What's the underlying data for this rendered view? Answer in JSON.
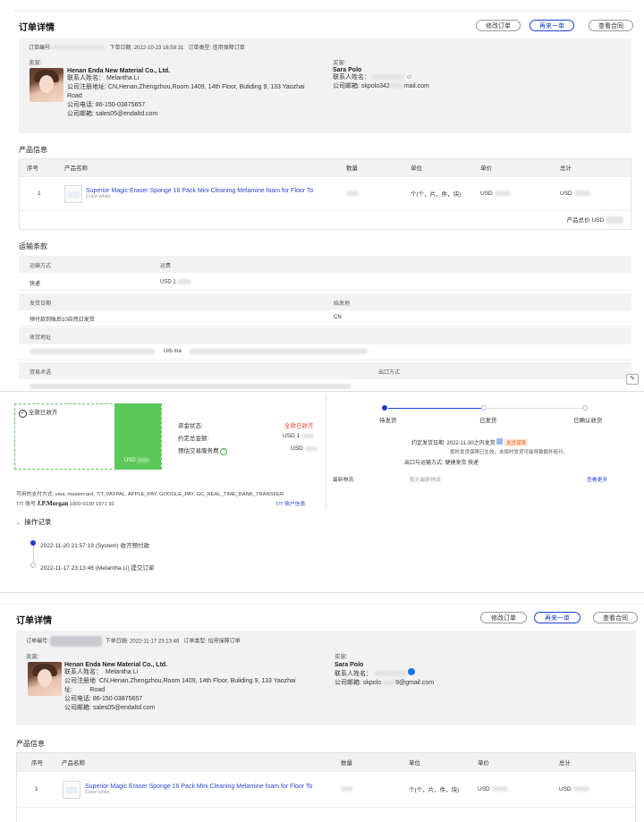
{
  "top": {
    "title": "订单详情",
    "buttons": {
      "modify": "修改订单",
      "reorder": "再来一单",
      "contract": "查看合同"
    },
    "meta_order_no_label": "订单编号:",
    "meta_date": "下单日期: 2022-10-23 16:59:31",
    "meta_type": "订单类型: 信用保障订单",
    "seller_label": "卖家:",
    "buyer_label": "买家:",
    "seller": {
      "company": "Henan Enda New Material Co., Ltd.",
      "contact": "联系人姓名： Melantha Li",
      "address1": "公司注册地址: CN,Henan,Zhengzhou,Room 1409, 14th Floor, Buliding 9, 133 Yaozhai",
      "address2": "Road",
      "phone": "公司电话: 86-150-03875657",
      "email": "公司邮箱: sales05@endaltd.com"
    },
    "buyer": {
      "name": "Sara Polo",
      "contact": "联系人姓名：",
      "email_prefix": "公司邮箱: skpolo342",
      "email_suffix": "mail.com"
    }
  },
  "product": {
    "section": "产品信息",
    "headers": [
      "序号",
      "产品名称",
      "数量",
      "单位",
      "单价",
      "总计"
    ],
    "row": {
      "index": "1",
      "name": "Superior Magic Eraser Sponge 16 Pack Mini Cleaning Melamine foam for Floor To",
      "sub": "Color:white",
      "unit": "个(个，片，件，块)",
      "price": "USD",
      "total": "USD"
    },
    "total_label": "产品总价  USD"
  },
  "shipping": {
    "section": "运输条款",
    "method_label": "运输方式",
    "fee_label": "运费",
    "method": "快递",
    "fee": "USD 1",
    "ship_date_label": "发货日期",
    "origin_label": "始发地",
    "ship_date": "预付款到账后10自然日发货",
    "origin": "CN",
    "address_label": "收货地址",
    "address_partial": "Urb ma",
    "trade_label": "贸易术语",
    "port_label": "出口方式"
  },
  "payment": {
    "status_tag": "全款已收齐",
    "usd_small": "USD",
    "fund_status_label": "资金状态:",
    "fund_status": "全款已收齐",
    "agreed_total_label": "约定总金额:",
    "agreed_total": "USD 1",
    "service_fee_label": "预估交易服务费",
    "service_fee": "USD",
    "methods": "可用的支付方式: visa, mastercard, T/T, PAYPAL, APPLE_PAY, GOOGLE_PAY, GC_REAL_TIME_BANK_TRANSFER",
    "tt_label": "T/T 账号",
    "bank": "J.P.Morgan",
    "tt_number": "1000 0130 1971 92",
    "tt_link": "T/T 账户信息"
  },
  "progress": {
    "steps": [
      "待发货",
      "已发货",
      "已确认收货"
    ],
    "agreed_ship_label": "约定发货日期:",
    "agreed_ship": "2022-11-30之内发货",
    "guarantee_tag": "发货保障",
    "guarantee_note": "按时发货保障已生效，未按时发货可能导致额外赔付。",
    "port_method_label": "出口与运输方式:",
    "port_method": "便捷发货 快递",
    "logistics_label": "最新物流:",
    "logistics_value": "暂无最新物流",
    "more": "查看更多"
  },
  "log": {
    "title": "操作记录",
    "entries": [
      "2022-11-20 21:57:19 (System) 收齐预付款",
      "2022-11-17 23:13:46 (Melantha Li) 提交订单"
    ]
  },
  "bottom": {
    "title": "订单详情",
    "buttons": {
      "modify": "修改订单",
      "reorder": "再来一单",
      "contract": "查看合同"
    },
    "meta_order_no_label": "订单编号:",
    "meta_date": "下单日期: 2022-11-17 23:13:46",
    "meta_type": "订单类型: 信用保障订单",
    "seller_label": "卖家:",
    "buyer_label": "买家:",
    "seller": {
      "company": "Henan Enda New Material Co., Ltd.",
      "contact_label": "联系人姓名：",
      "contact": "Melantha Li",
      "address_label1": "公司注册地",
      "address_label2": "址:",
      "address1": "CN,Henan,Zhengzhou,Room 1409, 14th Floor, Buliding 9, 133 Yaozhai",
      "address2": "Road",
      "phone": "公司电话: 86-150-03875657",
      "email": "公司邮箱: sales05@endaltd.com"
    },
    "buyer": {
      "name": "Sara Polo",
      "contact": "联系人姓名：",
      "email_prefix": "公司邮箱: skpolo",
      "email_suffix": "9@gmail.com"
    },
    "product_section": "产品信息",
    "headers": [
      "序号",
      "产品名称",
      "数量",
      "单位",
      "单价",
      "总计"
    ],
    "row": {
      "index": "1",
      "name": "Superior Magic Eraser Sponge 16 Pack Mini Cleaning Melamine foam for Floor To",
      "sub": "Color:white",
      "unit": "个(个，片，件，块)",
      "price": "USD",
      "total": "USD"
    }
  }
}
